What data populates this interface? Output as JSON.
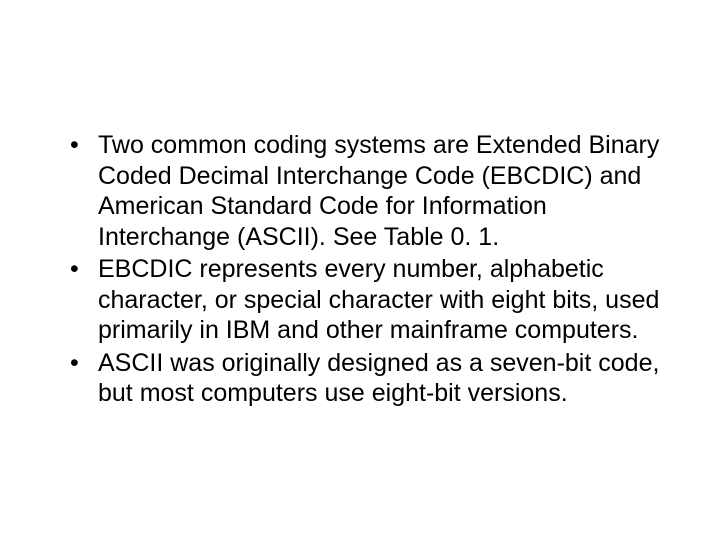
{
  "bullets": [
    "Two common coding systems are Extended Binary Coded Decimal Interchange Code (EBCDIC) and American Standard Code for Information Interchange (ASCII). See Table 0. 1.",
    "EBCDIC represents every number, alphabetic character, or special character with eight bits, used primarily in IBM and other mainframe computers.",
    "ASCII was originally designed as a seven-bit code, but most computers use eight-bit versions."
  ]
}
